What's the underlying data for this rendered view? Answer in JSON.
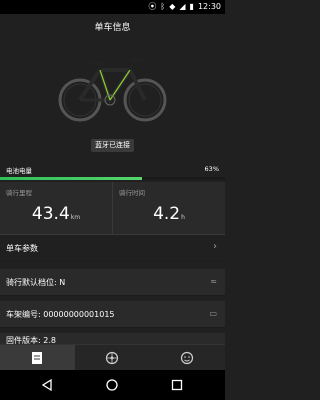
{
  "status_bar": {
    "time": "12:30"
  },
  "header": {
    "title": "单车信息"
  },
  "bike": {
    "image_label": "bicycle-image"
  },
  "bluetooth_status": "蓝牙已连接",
  "battery": {
    "label": "电池电量",
    "percent_text": "63%",
    "level": 0.63,
    "color": "#2fbf58"
  },
  "stats": {
    "distance": {
      "label": "骑行里程",
      "value": "43.4",
      "unit": "km"
    },
    "time": {
      "label": "骑行时间",
      "value": "4.2",
      "unit": "h"
    }
  },
  "params": {
    "section_title": "单车参数",
    "items": [
      {
        "label": "骑行默认档位: ",
        "value": "N"
      },
      {
        "label": "车架编号: ",
        "value": "00000000001015"
      },
      {
        "label": "固件版本: ",
        "value": "2.8"
      }
    ]
  },
  "tabs": [
    {
      "name": "bike-info"
    },
    {
      "name": "ride"
    },
    {
      "name": "profile"
    }
  ]
}
